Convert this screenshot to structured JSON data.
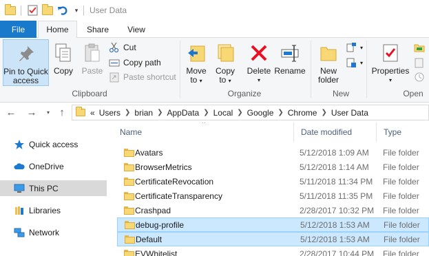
{
  "window": {
    "title": "User Data"
  },
  "ribbon_tabs": [
    "File",
    "Home",
    "Share",
    "View"
  ],
  "clipboard": {
    "pin_label_1": "Pin to Quick",
    "pin_label_2": "access",
    "copy": "Copy",
    "paste": "Paste",
    "cut": "Cut",
    "copy_path": "Copy path",
    "paste_shortcut": "Paste shortcut",
    "group_label": "Clipboard"
  },
  "organize": {
    "move_to_1": "Move",
    "move_to_2": "to",
    "copy_to_1": "Copy",
    "copy_to_2": "to",
    "delete": "Delete",
    "rename": "Rename",
    "group_label": "Organize"
  },
  "new": {
    "new_folder_1": "New",
    "new_folder_2": "folder",
    "group_label": "New"
  },
  "open": {
    "properties": "Properties",
    "group_label": "Open"
  },
  "address": {
    "overflow": "«",
    "crumbs": [
      "Users",
      "brian",
      "AppData",
      "Local",
      "Google",
      "Chrome",
      "User Data"
    ]
  },
  "navpane": {
    "items": [
      "Quick access",
      "OneDrive",
      "This PC",
      "Libraries",
      "Network"
    ],
    "selected": "This PC"
  },
  "columns": {
    "name": "Name",
    "date": "Date modified",
    "type": "Type"
  },
  "files": [
    {
      "name": "Avatars",
      "date": "5/12/2018 1:09 AM",
      "type": "File folder"
    },
    {
      "name": "BrowserMetrics",
      "date": "5/12/2018 1:14 AM",
      "type": "File folder"
    },
    {
      "name": "CertificateRevocation",
      "date": "5/11/2018 11:34 PM",
      "type": "File folder"
    },
    {
      "name": "CertificateTransparency",
      "date": "5/11/2018 11:35 PM",
      "type": "File folder"
    },
    {
      "name": "Crashpad",
      "date": "2/28/2017 10:32 PM",
      "type": "File folder"
    },
    {
      "name": "debug-profile",
      "date": "5/12/2018 1:53 AM",
      "type": "File folder"
    },
    {
      "name": "Default",
      "date": "5/12/2018 1:53 AM",
      "type": "File folder"
    },
    {
      "name": "EVWhitelist",
      "date": "2/28/2017 10:44 PM",
      "type": "File folder"
    }
  ],
  "colors": {
    "accent": "#1979ca",
    "selection": "#cce8ff",
    "folder": "#f8d775",
    "delete_red": "#e81123"
  }
}
